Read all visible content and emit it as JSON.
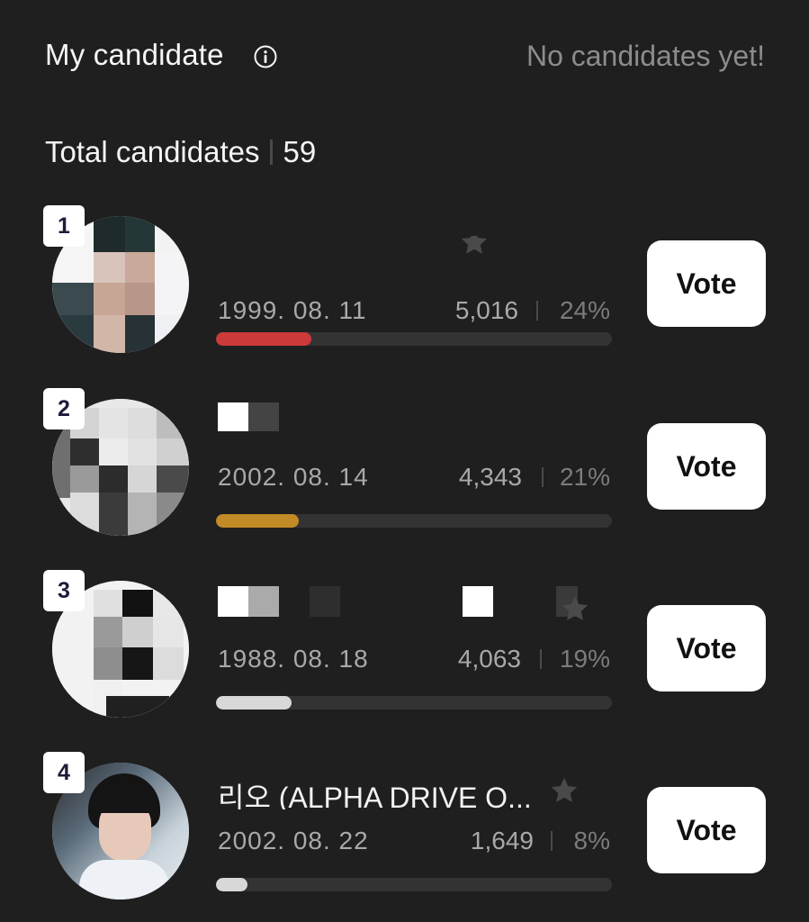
{
  "header": {
    "my_candidate_label": "My candidate",
    "no_candidates_text": "No candidates yet!"
  },
  "summary": {
    "total_label": "Total candidates",
    "total_count": "59"
  },
  "candidates": [
    {
      "rank": "1",
      "name": "",
      "birthdate": "1999. 08. 11",
      "votes": "5,016",
      "percent": "24%",
      "progress": 0.24,
      "bar_color": "#cc3a3a",
      "vote_label": "Vote"
    },
    {
      "rank": "2",
      "name": "",
      "birthdate": "2002. 08. 14",
      "votes": "4,343",
      "percent": "21%",
      "progress": 0.21,
      "bar_color": "#c38b25",
      "vote_label": "Vote"
    },
    {
      "rank": "3",
      "name": "",
      "birthdate": "1988. 08. 18",
      "votes": "4,063",
      "percent": "19%",
      "progress": 0.19,
      "bar_color": "#d8d8d8",
      "vote_label": "Vote"
    },
    {
      "rank": "4",
      "name": "리오 (ALPHA DRIVE O...",
      "birthdate": "2002. 08. 22",
      "votes": "1,649",
      "percent": "8%",
      "progress": 0.08,
      "bar_color": "#d8d8d8",
      "vote_label": "Vote"
    }
  ],
  "icons": {
    "info": "info-circle-icon",
    "star": "star-icon"
  }
}
